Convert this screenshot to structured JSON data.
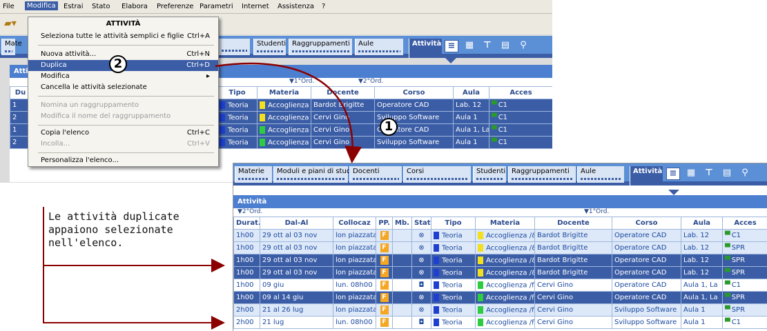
{
  "menubar": {
    "items": [
      "File",
      "Modifica",
      "Estrai",
      "Stato",
      "Elabora",
      "Preferenze",
      "Parametri",
      "Internet",
      "Assistenza",
      "?"
    ]
  },
  "dropdown": {
    "title": "ATTIVITÀ",
    "items": [
      {
        "label": "Seleziona tutte le attività semplici e figlie",
        "shortcut": "Ctrl+A"
      },
      {
        "label": "Nuova attività...",
        "shortcut": "Ctrl+N"
      },
      {
        "label": "Duplica",
        "shortcut": "Ctrl+D"
      },
      {
        "label": "Modifica",
        "shortcut": ""
      },
      {
        "label": "Cancella le attività selezionate",
        "shortcut": ""
      },
      {
        "label": "Nomina un raggruppamento",
        "shortcut": ""
      },
      {
        "label": "Modifica il nome del raggruppamento",
        "shortcut": ""
      },
      {
        "label": "Copia l'elenco",
        "shortcut": "Ctrl+C"
      },
      {
        "label": "Incolla...",
        "shortcut": "Ctrl+V"
      },
      {
        "label": "Personalizza l'elenco...",
        "shortcut": ""
      }
    ]
  },
  "markers": {
    "one": "1",
    "two": "2"
  },
  "top": {
    "tabs": [
      "Mate",
      "Studenti",
      "Raggruppamenti",
      "Aule",
      "Attività"
    ],
    "panel_title": "Atti",
    "sort1": "▼1°Ord.",
    "sort2": "▼2°Ord.",
    "headers": [
      "Du",
      "Tipo",
      "Materia",
      "Docente",
      "Corso",
      "Aula",
      "Acces"
    ],
    "rows": [
      {
        "du": "1",
        "tipo": "Teoria",
        "materia": "Accoglienza /&",
        "docente": "Bardot Brigitte",
        "corso": "Operatore CAD",
        "aula": "Lab. 12",
        "acc": "C1",
        "mcol": "#f2e020"
      },
      {
        "du": "2",
        "tipo": "Teoria",
        "materia": "Accoglienza /&",
        "docente": "Cervi Gino",
        "corso": "Sviluppo Software",
        "aula": "Aula 1",
        "acc": "C1",
        "mcol": "#f2e020"
      },
      {
        "du": "1",
        "tipo": "Teoria",
        "materia": "Accoglienza /f",
        "docente": "Cervi Gino",
        "corso": "Operatore CAD",
        "aula": "Aula 1, La",
        "acc": "C1",
        "mcol": "#2ecc40"
      },
      {
        "du": "2",
        "tipo": "Teoria",
        "materia": "Accoglienza /f",
        "docente": "Cervi Gino",
        "corso": "Sviluppo Software",
        "aula": "Aula 1",
        "acc": "C1",
        "mcol": "#2ecc40"
      }
    ]
  },
  "bottom": {
    "tabs": [
      "Materie",
      "Moduli e piani di studi",
      "Docenti",
      "Corsi",
      "Studenti",
      "Raggruppamenti",
      "Aule",
      "Attività"
    ],
    "panel_title": "Attività",
    "sort2": "▼2°Ord.",
    "sort1": "▼1°Ord.",
    "headers": [
      "Durat.",
      "Dal-Al",
      "Collocaz",
      "PP.",
      "Mb.",
      "Stat",
      "Tipo",
      "Materia",
      "Docente",
      "Corso",
      "Aula",
      "Acces"
    ],
    "rows": [
      {
        "style": "lt",
        "dur": "1h00",
        "dal": "29 ott al 03 nov",
        "col": "lon piazzata",
        "pp": "F",
        "stat": "⊗",
        "tipo": "Teoria",
        "materia": "Accoglienza /&",
        "docente": "Bardot Brigitte",
        "corso": "Operatore CAD",
        "aula": "Lab. 12",
        "acc": "C1",
        "mcol": "#f2e020"
      },
      {
        "style": "lt",
        "dur": "1h00",
        "dal": "29 ott al 03 nov",
        "col": "lon piazzata",
        "pp": "F",
        "stat": "⊗",
        "tipo": "Teoria",
        "materia": "Accoglienza /&",
        "docente": "Bardot Brigitte",
        "corso": "Operatore CAD",
        "aula": "Lab. 12",
        "acc": "SPR",
        "mcol": "#f2e020"
      },
      {
        "style": "sel",
        "dur": "1h00",
        "dal": "29 ott al 03 nov",
        "col": "lon piazzata",
        "pp": "F",
        "stat": "⊗",
        "tipo": "Teoria",
        "materia": "Accoglienza /&",
        "docente": "Bardot Brigitte",
        "corso": "Operatore CAD",
        "aula": "Lab. 12",
        "acc": "SPR",
        "mcol": "#f2e020"
      },
      {
        "style": "sel",
        "dur": "1h00",
        "dal": "29 ott al 03 nov",
        "col": "lon piazzata",
        "pp": "F",
        "stat": "⊗",
        "tipo": "Teoria",
        "materia": "Accoglienza /&",
        "docente": "Bardot Brigitte",
        "corso": "Operatore CAD",
        "aula": "Lab. 12",
        "acc": "SPR",
        "mcol": "#f2e020"
      },
      {
        "style": "wh",
        "dur": "1h00",
        "dal": "09 giu",
        "col": "lun. 08h00",
        "pp": "F",
        "stat": "◘",
        "tipo": "Teoria",
        "materia": "Accoglienza /f",
        "docente": "Cervi Gino",
        "corso": "Operatore CAD",
        "aula": "Aula 1, La",
        "acc": "C1",
        "mcol": "#2ecc40"
      },
      {
        "style": "sel",
        "dur": "1h00",
        "dal": "09 al 14 giu",
        "col": "lon piazzata",
        "pp": "F",
        "stat": "⊗",
        "tipo": "Teoria",
        "materia": "Accoglienza /f",
        "docente": "Cervi Gino",
        "corso": "Operatore CAD",
        "aula": "Aula 1, La",
        "acc": "SPR",
        "mcol": "#2ecc40"
      },
      {
        "style": "lt",
        "dur": "2h00",
        "dal": "21 al 26 lug",
        "col": "lon piazzata",
        "pp": "F",
        "stat": "⊗",
        "tipo": "Teoria",
        "materia": "Accoglienza /f",
        "docente": "Cervi Gino",
        "corso": "Sviluppo Software",
        "aula": "Aula 1",
        "acc": "SPR",
        "mcol": "#2ecc40"
      },
      {
        "style": "wh",
        "dur": "2h00",
        "dal": "21 lug",
        "col": "lun. 08h00",
        "pp": "F",
        "stat": "◘",
        "tipo": "Teoria",
        "materia": "Accoglienza /f",
        "docente": "Cervi Gino",
        "corso": "Sviluppo Software",
        "aula": "Aula 1",
        "acc": "C1",
        "mcol": "#2ecc40"
      }
    ]
  },
  "callout": {
    "text": "Le attività duplicate appaiono selezionate nell'elenco."
  }
}
